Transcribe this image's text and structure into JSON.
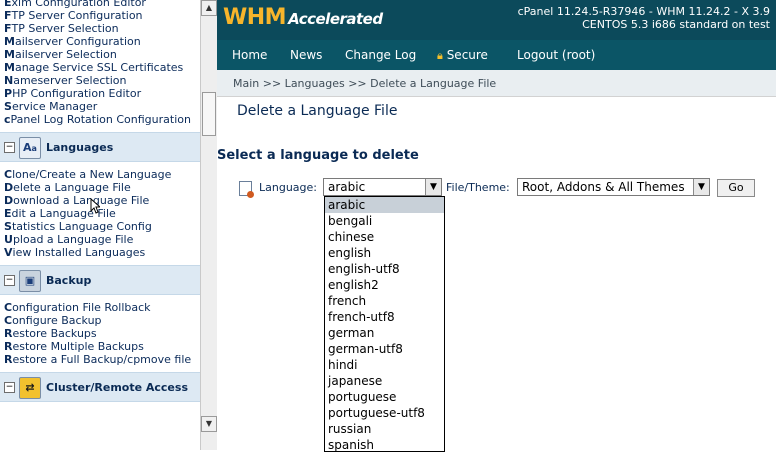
{
  "left_panel": {
    "group_top": [
      {
        "first": "E",
        "rest": "xim Configuration Editor"
      },
      {
        "first": "F",
        "rest": "TP Server Configuration"
      },
      {
        "first": "F",
        "rest": "TP Server Selection"
      },
      {
        "first": "M",
        "rest": "ailserver Configuration"
      },
      {
        "first": "M",
        "rest": "ailserver Selection"
      },
      {
        "first": "M",
        "rest": "anage Service SSL Certificates"
      },
      {
        "first": "N",
        "rest": "ameserver Selection"
      },
      {
        "first": "P",
        "rest": "HP Configuration Editor"
      },
      {
        "first": "S",
        "rest": "ervice Manager"
      },
      {
        "first": "c",
        "rest": "Panel Log Rotation Configuration"
      }
    ],
    "sections": {
      "languages": {
        "title": "Languages",
        "icon": "languages-icon",
        "items": [
          {
            "first": "C",
            "rest": "lone/Create a New Language"
          },
          {
            "first": "D",
            "rest": "elete a Language File"
          },
          {
            "first": "D",
            "rest": "ownload a Language File"
          },
          {
            "first": "E",
            "rest": "dit a Language File"
          },
          {
            "first": "S",
            "rest": "tatistics Language Config"
          },
          {
            "first": "U",
            "rest": "pload a Language File"
          },
          {
            "first": "V",
            "rest": "iew Installed Languages"
          }
        ]
      },
      "backup": {
        "title": "Backup",
        "icon": "backup-icon",
        "items": [
          {
            "first": "C",
            "rest": "onfiguration File Rollback"
          },
          {
            "first": "C",
            "rest": "onfigure Backup"
          },
          {
            "first": "R",
            "rest": "estore Backups"
          },
          {
            "first": "R",
            "rest": "estore Multiple Backups"
          },
          {
            "first": "R",
            "rest": "estore a Full Backup/cpmove file"
          }
        ]
      },
      "cluster": {
        "title": "Cluster/Remote Access",
        "icon": "cluster-icon"
      }
    }
  },
  "header": {
    "logo_main": "WHM",
    "logo_sub": "Accelerated",
    "version_line1": "cPanel 11.24.5-R37946 - WHM 11.24.2 - X 3.9",
    "version_line2": "CENTOS 5.3 i686 standard on test"
  },
  "nav": {
    "home": "Home",
    "news": "News",
    "changelog": "Change Log",
    "secure": "Secure",
    "logout": "Logout (root)"
  },
  "breadcrumb": "Main >> Languages >> Delete a Language File",
  "page": {
    "title": "Delete a Language File",
    "section_title": "Select a language to delete",
    "language_label": "Language:",
    "language_selected": "arabic",
    "theme_label": "File/Theme:",
    "theme_selected": "Root, Addons & All Themes",
    "go_label": "Go"
  },
  "language_options": [
    "arabic",
    "bengali",
    "chinese",
    "english",
    "english-utf8",
    "english2",
    "french",
    "french-utf8",
    "german",
    "german-utf8",
    "hindi",
    "japanese",
    "portuguese",
    "portuguese-utf8",
    "russian",
    "spanish"
  ]
}
